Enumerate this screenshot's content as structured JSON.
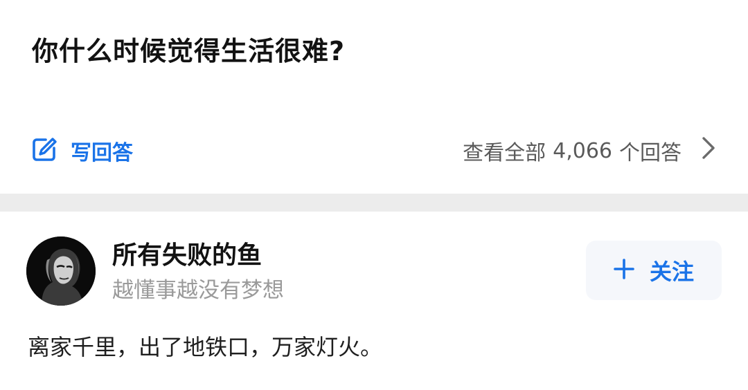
{
  "question": {
    "title": "你什么时候觉得生活很难?"
  },
  "actions": {
    "write_answer_label": "写回答",
    "view_all_prefix": "查看全部",
    "answer_count": "4,066",
    "view_all_suffix": "个回答"
  },
  "answer": {
    "author_name": "所有失败的鱼",
    "author_bio": "越懂事越没有梦想",
    "follow_label": "关注",
    "excerpt": "离家千里，出了地铁口，万家灯火。"
  },
  "icons": {
    "write": "edit-pencil-icon",
    "chevron": "chevron-right-icon",
    "plus": "plus-icon",
    "avatar": "portrait-avatar"
  },
  "colors": {
    "accent": "#1a73e8",
    "divider": "#ececec",
    "muted_text": "#9a9a9a"
  }
}
